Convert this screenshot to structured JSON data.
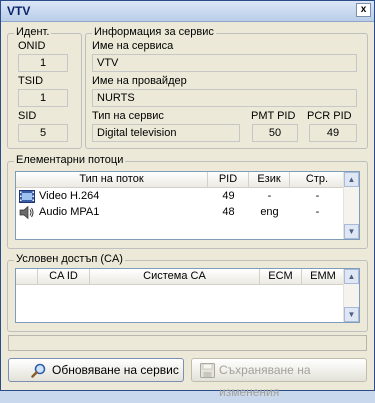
{
  "window": {
    "title": "VTV",
    "close_glyph": "x"
  },
  "ident": {
    "group_label": "Идент.",
    "onid_label": "ONID",
    "onid_value": "1",
    "tsid_label": "TSID",
    "tsid_value": "1",
    "sid_label": "SID",
    "sid_value": "5"
  },
  "service_info": {
    "group_label": "Информация за сервис",
    "service_name_label": "Име на сервиса",
    "service_name_value": "VTV",
    "provider_label": "Име на провайдер",
    "provider_value": "NURTS",
    "service_type_label": "Тип на сервис",
    "service_type_value": "Digital television",
    "pmt_pid_label": "PMT PID",
    "pmt_pid_value": "50",
    "pcr_pid_label": "PCR PID",
    "pcr_pid_value": "49"
  },
  "streams": {
    "group_label": "Елементарни потоци",
    "columns": [
      "Тип на поток",
      "PID",
      "Език",
      "Стр."
    ],
    "rows": [
      {
        "icon": "video-icon",
        "type": "Video H.264",
        "pid": "49",
        "lang": "-",
        "page": "-"
      },
      {
        "icon": "audio-icon",
        "type": "Audio MPA1",
        "pid": "48",
        "lang": "eng",
        "page": "-"
      }
    ]
  },
  "ca": {
    "group_label": "Условен достъп (CA)",
    "columns": [
      "CA ID",
      "Система CA",
      "ECM",
      "EMM"
    ]
  },
  "buttons": {
    "refresh_label": "Обновяване на сервис",
    "save_label": "Съхраняване на изменения"
  }
}
